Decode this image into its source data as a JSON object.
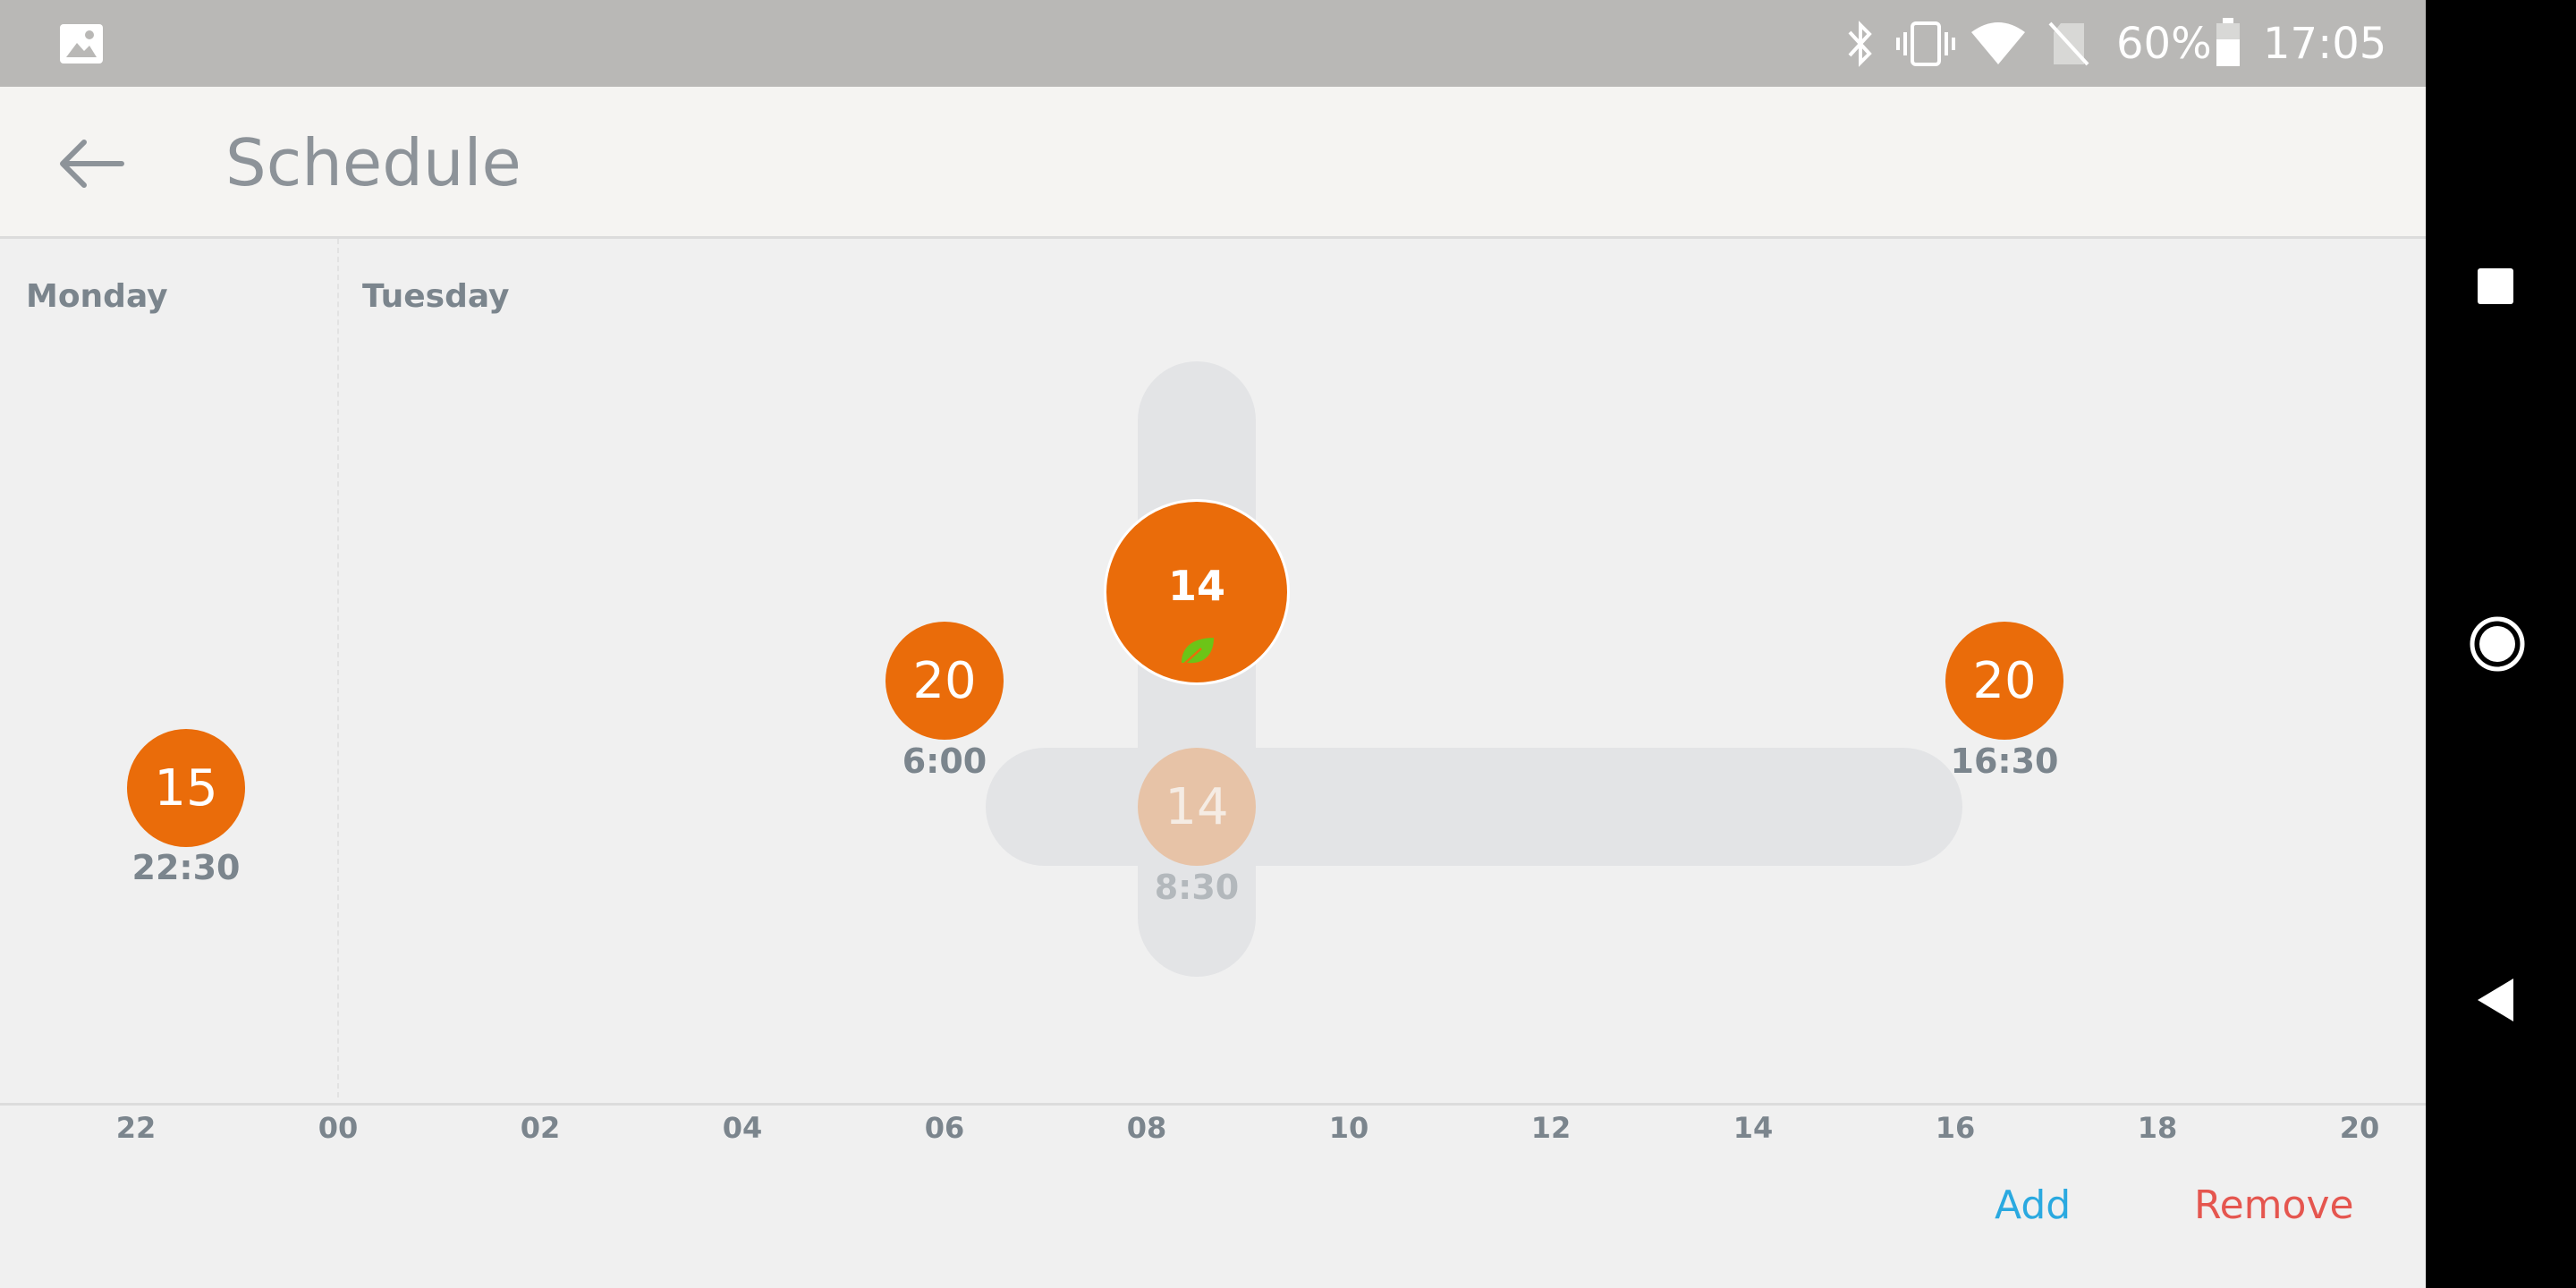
{
  "status_bar": {
    "battery": "60%",
    "clock": "17:05"
  },
  "app_bar": {
    "title": "Schedule"
  },
  "days": [
    "Monday",
    "Tuesday"
  ],
  "time_axis": [
    "22",
    "00",
    "02",
    "04",
    "06",
    "08",
    "10",
    "12",
    "14",
    "16",
    "18",
    "20"
  ],
  "setpoints": [
    {
      "temp": "15",
      "time": "22:30"
    },
    {
      "temp": "20",
      "time": "6:00"
    },
    {
      "temp": "14",
      "time": "8:30"
    },
    {
      "temp": "20",
      "time": "16:30"
    }
  ],
  "selected": {
    "temp": "14",
    "eco": true
  },
  "actions": {
    "add": "Add",
    "remove": "Remove"
  },
  "colors": {
    "setpoint": "#ea6c0a",
    "add": "#2aa9e0",
    "remove": "#e5564f",
    "eco_leaf": "#6cc417"
  }
}
